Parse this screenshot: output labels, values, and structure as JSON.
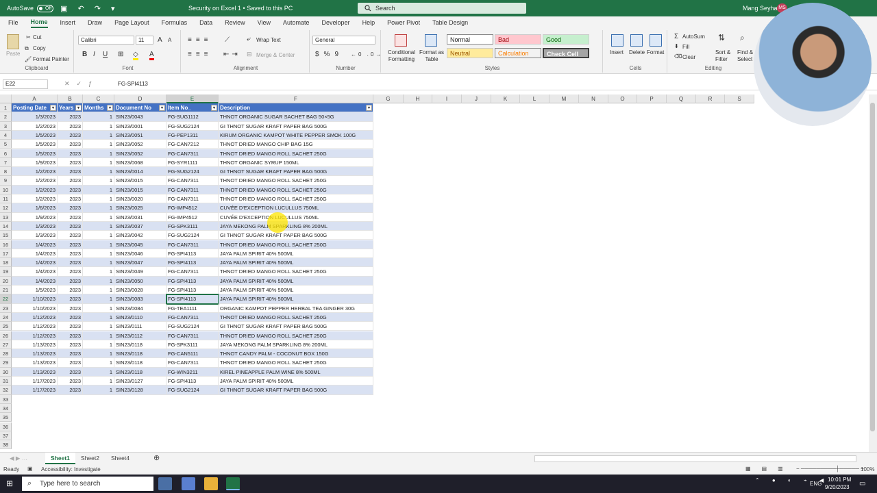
{
  "titlebar": {
    "autosave_label": "AutoSave",
    "autosave_state": "Off",
    "document_title": "Security on Excel 1 • Saved to this PC",
    "search_placeholder": "Search",
    "user_name": "Mang Seyha",
    "user_initials": "MS"
  },
  "ribbon_tabs": [
    "File",
    "Home",
    "Insert",
    "Draw",
    "Page Layout",
    "Formulas",
    "Data",
    "Review",
    "View",
    "Automate",
    "Developer",
    "Help",
    "Power Pivot",
    "Table Design"
  ],
  "ribbon": {
    "clipboard": {
      "paste": "Paste",
      "cut": "Cut",
      "copy": "Copy",
      "format_painter": "Format Painter",
      "label": "Clipboard"
    },
    "font": {
      "font_name": "Calibri",
      "font_size": "11",
      "label": "Font"
    },
    "alignment": {
      "wrap_text": "Wrap Text",
      "merge_center": "Merge & Center",
      "label": "Alignment"
    },
    "number": {
      "format": "General",
      "label": "Number"
    },
    "styles": {
      "conditional_formatting": "Conditional Formatting",
      "format_as_table": "Format as Table",
      "normal": "Normal",
      "bad": "Bad",
      "good": "Good",
      "neutral": "Neutral",
      "calculation": "Calculation",
      "check_cell": "Check Cell",
      "label": "Styles"
    },
    "cells": {
      "insert": "Insert",
      "delete": "Delete",
      "format": "Format",
      "label": "Cells"
    },
    "editing": {
      "autosum": "AutoSum",
      "fill": "Fill",
      "clear": "Clear",
      "sort_filter": "Sort & Filter",
      "find_select": "Find & Select",
      "label": "Editing"
    }
  },
  "formula_bar": {
    "name_box": "E22",
    "formula": "FG-SPI4113"
  },
  "columns": [
    "A",
    "B",
    "C",
    "D",
    "E",
    "F",
    "G",
    "H",
    "I",
    "J",
    "K",
    "L",
    "M",
    "N",
    "O",
    "P",
    "Q",
    "R",
    "S"
  ],
  "table": {
    "headers": [
      "Posting Date",
      "Years",
      "Months",
      "Document No",
      "Item No_",
      "Description"
    ],
    "rows": [
      [
        "1/3/2023",
        "2023",
        "1",
        "SIN23/0043",
        "FG-SUG1112",
        "THNOT ORGANIC SUGAR SACHET BAG 50×5G"
      ],
      [
        "1/2/2023",
        "2023",
        "1",
        "SIN23/0001",
        "FG-SUG2124",
        "GI THNOT SUGAR KRAFT PAPER BAG 500G"
      ],
      [
        "1/5/2023",
        "2023",
        "1",
        "SIN23/0051",
        "FG-PEP1311",
        "KIRUM ORGANIC KAMPOT WHITE PEPPER SMOK 100G"
      ],
      [
        "1/5/2023",
        "2023",
        "1",
        "SIN23/0052",
        "FG-CAN7212",
        "THNOT DRIED MANGO CHIP BAG 15G"
      ],
      [
        "1/5/2023",
        "2023",
        "1",
        "SIN23/0052",
        "FG-CAN7311",
        "THNOT DRIED MANGO ROLL SACHET 250G"
      ],
      [
        "1/9/2023",
        "2023",
        "1",
        "SIN23/0068",
        "FG-SYR1111",
        "THNOT ORGANIC SYRUP 150ML"
      ],
      [
        "1/2/2023",
        "2023",
        "1",
        "SIN23/0014",
        "FG-SUG2124",
        "GI THNOT SUGAR KRAFT PAPER BAG 500G"
      ],
      [
        "1/2/2023",
        "2023",
        "1",
        "SIN23/0015",
        "FG-CAN7311",
        "THNOT DRIED MANGO ROLL SACHET 250G"
      ],
      [
        "1/2/2023",
        "2023",
        "1",
        "SIN23/0015",
        "FG-CAN7311",
        "THNOT DRIED MANGO ROLL SACHET 250G"
      ],
      [
        "1/2/2023",
        "2023",
        "1",
        "SIN23/0020",
        "FG-CAN7311",
        "THNOT DRIED MANGO ROLL SACHET 250G"
      ],
      [
        "1/6/2023",
        "2023",
        "1",
        "SIN23/0025",
        "FG-IMP4512",
        "CUVÉE D'EXCEPTION LUCULLUS 750ML"
      ],
      [
        "1/9/2023",
        "2023",
        "1",
        "SIN23/0031",
        "FG-IMP4512",
        "CUVÉE D'EXCEPTION LUCULLUS 750ML"
      ],
      [
        "1/3/2023",
        "2023",
        "1",
        "SIN23/0037",
        "FG-SPK3111",
        "JAYA MEKONG PALM SPARKLING 8% 200ML"
      ],
      [
        "1/3/2023",
        "2023",
        "1",
        "SIN23/0042",
        "FG-SUG2124",
        "GI THNOT SUGAR KRAFT PAPER BAG 500G"
      ],
      [
        "1/4/2023",
        "2023",
        "1",
        "SIN23/0045",
        "FG-CAN7311",
        "THNOT DRIED MANGO ROLL SACHET 250G"
      ],
      [
        "1/4/2023",
        "2023",
        "1",
        "SIN23/0046",
        "FG-SPI4113",
        "JAYA PALM SPIRIT 40% 500ML"
      ],
      [
        "1/4/2023",
        "2023",
        "1",
        "SIN23/0047",
        "FG-SPI4113",
        "JAYA PALM SPIRIT 40% 500ML"
      ],
      [
        "1/4/2023",
        "2023",
        "1",
        "SIN23/0049",
        "FG-CAN7311",
        "THNOT DRIED MANGO ROLL SACHET 250G"
      ],
      [
        "1/4/2023",
        "2023",
        "1",
        "SIN23/0050",
        "FG-SPI4113",
        "JAYA PALM SPIRIT 40% 500ML"
      ],
      [
        "1/5/2023",
        "2023",
        "1",
        "SIN23/0028",
        "FG-SPI4113",
        "JAYA PALM SPIRIT 40% 500ML"
      ],
      [
        "1/10/2023",
        "2023",
        "1",
        "SIN23/0083",
        "FG-SPI4113",
        "JAYA PALM SPIRIT 40% 500ML"
      ],
      [
        "1/10/2023",
        "2023",
        "1",
        "SIN23/0084",
        "FG-TEA1111",
        "ORGANIC KAMPOT PEPPER HERBAL TEA GINGER 30G"
      ],
      [
        "1/12/2023",
        "2023",
        "1",
        "SIN23/0110",
        "FG-CAN7311",
        "THNOT DRIED MANGO ROLL SACHET 250G"
      ],
      [
        "1/12/2023",
        "2023",
        "1",
        "SIN23/0111",
        "FG-SUG2124",
        "GI THNOT SUGAR KRAFT PAPER BAG 500G"
      ],
      [
        "1/12/2023",
        "2023",
        "1",
        "SIN23/0112",
        "FG-CAN7311",
        "THNOT DRIED MANGO ROLL SACHET 250G"
      ],
      [
        "1/13/2023",
        "2023",
        "1",
        "SIN23/0118",
        "FG-SPK3111",
        "JAYA MEKONG PALM SPARKLING 8% 200ML"
      ],
      [
        "1/13/2023",
        "2023",
        "1",
        "SIN23/0118",
        "FG-CAN5111",
        "THNOT CANDY PALM - COCONUT BOX 150G"
      ],
      [
        "1/13/2023",
        "2023",
        "1",
        "SIN23/0118",
        "FG-CAN7311",
        "THNOT DRIED MANGO ROLL SACHET 250G"
      ],
      [
        "1/13/2023",
        "2023",
        "1",
        "SIN23/0118",
        "FG-WIN3211",
        "KIREL PINEAPPLE PALM WINE 8% 500ML"
      ],
      [
        "1/17/2023",
        "2023",
        "1",
        "SIN23/0127",
        "FG-SPI4113",
        "JAYA PALM SPIRIT 40% 500ML"
      ],
      [
        "1/17/2023",
        "2023",
        "1",
        "SIN23/0128",
        "FG-SUG2124",
        "GI THNOT SUGAR KRAFT PAPER BAG 500G"
      ]
    ]
  },
  "row_numbers": [
    "1",
    "2",
    "3",
    "4",
    "5",
    "6",
    "7",
    "8",
    "9",
    "10",
    "11",
    "12",
    "13",
    "14",
    "15",
    "16",
    "17",
    "18",
    "19",
    "20",
    "21",
    "22",
    "23",
    "24",
    "25",
    "26",
    "27",
    "28",
    "29",
    "30",
    "31",
    "32",
    "33",
    "34",
    "35",
    "36",
    "37",
    "38"
  ],
  "sheets": [
    "Sheet1",
    "Sheet2",
    "Sheet4"
  ],
  "active_sheet": "Sheet1",
  "status": {
    "ready": "Ready",
    "accessibility": "Accessibility: Investigate",
    "zoom": "100%"
  },
  "taskbar": {
    "search_placeholder": "Type here to search",
    "language": "ENG",
    "time": "10:01 PM",
    "date": "9/20/2023"
  },
  "colors": {
    "excel_green": "#217346",
    "table_header": "#4472c4",
    "band": "#d9e1f2"
  }
}
